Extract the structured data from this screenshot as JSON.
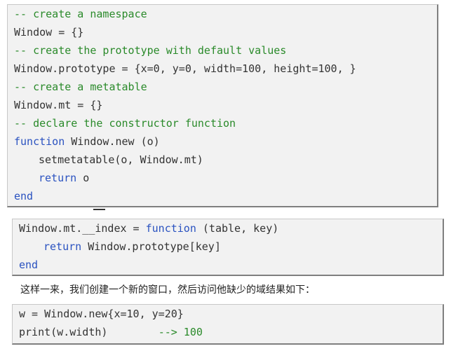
{
  "block1": {
    "line1": "-- create a namespace",
    "line2": "Window = {}",
    "line3": "-- create the prototype with default values",
    "line4": "Window.prototype = {x=0, y=0, width=100, height=100, }",
    "line5": "-- create a metatable",
    "line6": "Window.mt = {}",
    "line7": "-- declare the constructor function",
    "line8_kw": "function",
    "line8_rest": " Window.new (o)",
    "line9": "setmetatable(o, Window.mt)",
    "line10_kw": "return",
    "line10_rest": " o",
    "line11": "end"
  },
  "block2": {
    "line1_pre": "Window.mt.__index = ",
    "line1_kw": "function",
    "line1_post": " (table, key)",
    "line2_kw": "return",
    "line2_rest": " Window.prototype[key]",
    "line3": "end"
  },
  "sentence": "这样一来，我们创建一个新的窗口，然后访问他缺少的域结果如下：",
  "block3": {
    "line1": "w = Window.new{x=10, y=20}",
    "line2_pre": "print(w.width)        ",
    "line2_comment": "--> 100"
  },
  "colors": {
    "comment": "#2a8a2a",
    "keyword": "#2a52c0",
    "text": "#333333",
    "code_background": "#f2f2f2"
  }
}
